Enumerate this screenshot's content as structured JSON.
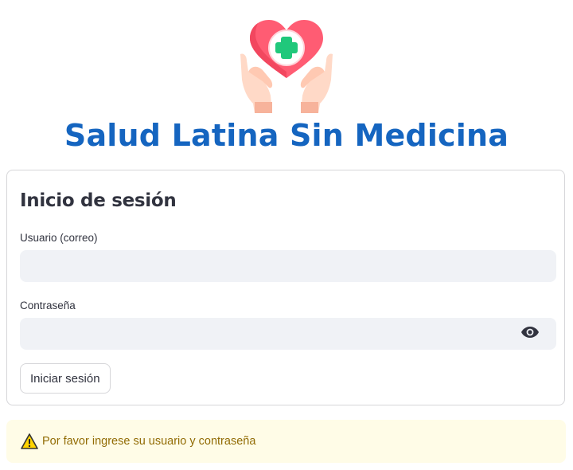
{
  "header": {
    "logo_icon": "heart-medical-cross-in-hands-icon",
    "title": "Salud Latina Sin Medicina"
  },
  "login_form": {
    "heading": "Inicio de sesión",
    "username": {
      "label": "Usuario (correo)",
      "value": "",
      "placeholder": ""
    },
    "password": {
      "label": "Contraseña",
      "value": "",
      "placeholder": "",
      "toggle_icon": "eye-icon"
    },
    "submit_label": "Iniciar sesión"
  },
  "alert": {
    "icon": "warning-icon",
    "message": "Por favor ingrese su usuario y contraseña"
  },
  "colors": {
    "title": "#1565c0",
    "heart": "#ff5c73",
    "cross": "#20c87b",
    "input_background": "#f0f2f6",
    "alert_background": "#fffce7",
    "alert_text": "#926c05"
  }
}
